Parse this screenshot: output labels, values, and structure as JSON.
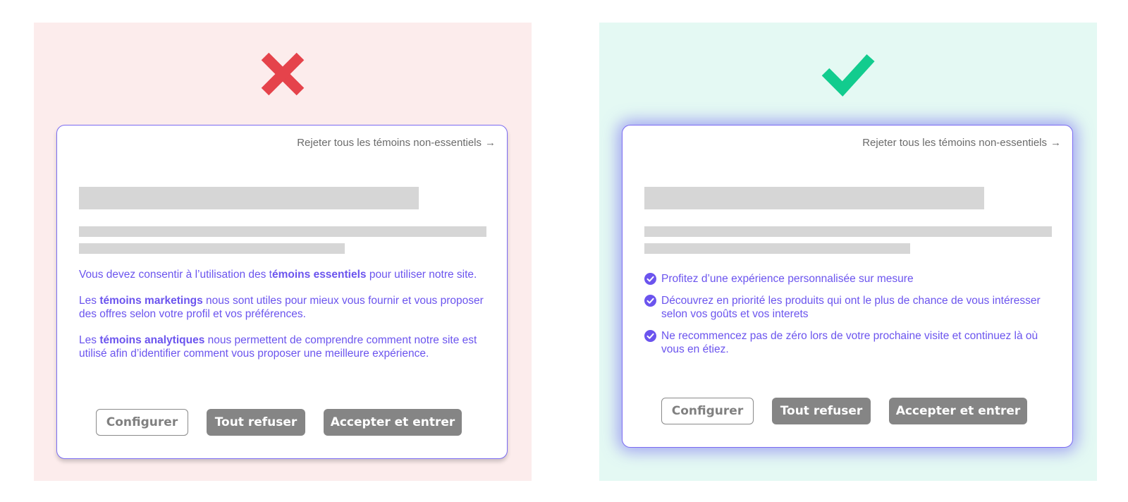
{
  "colors": {
    "bad_background": "#fcecec",
    "good_background": "#e4f9f3",
    "cross": "#e5434b",
    "check": "#12cc8e",
    "accent_text": "#6b54ee",
    "dialog_border": "#7b6bf2",
    "button_fill": "#858585"
  },
  "bad_example": {
    "verdict_icon": "red-cross-icon",
    "dialog": {
      "reject_link": "Rejeter tous les témoins non-essentiels",
      "reject_arrow": "→",
      "paragraphs": [
        {
          "before": "Vous devez consentir à l’utilisation des t",
          "bold": "émoins essentiels",
          "after": " pour utiliser notre site."
        },
        {
          "before": "Les ",
          "bold": "témoins marketings",
          "after": " nous sont utiles pour mieux vous fournir et vous proposer des offres selon votre profil et vos préférences."
        },
        {
          "before": "Les ",
          "bold": "témoins analytiques",
          "after": " nous permettent de comprendre comment notre site est utilisé afin d’identifier comment vous proposer une meilleure expérience."
        }
      ],
      "buttons": {
        "configure": "Configurer",
        "refuse_all": "Tout refuser",
        "accept": "Accepter et entrer"
      }
    }
  },
  "good_example": {
    "verdict_icon": "green-check-icon",
    "dialog": {
      "reject_link": "Rejeter tous les témoins non-essentiels",
      "reject_arrow": "→",
      "benefits": [
        "Profitez d’une expérience personnalisée sur mesure",
        "Découvrez en priorité les produits qui ont le plus de chance de vous intéresser selon vos goûts et vos interets",
        "Ne recommencez pas de zéro lors de votre prochaine visite et continuez là où vous en étiez."
      ],
      "buttons": {
        "configure": "Configurer",
        "refuse_all": "Tout refuser",
        "accept": "Accepter et entrer"
      }
    }
  }
}
